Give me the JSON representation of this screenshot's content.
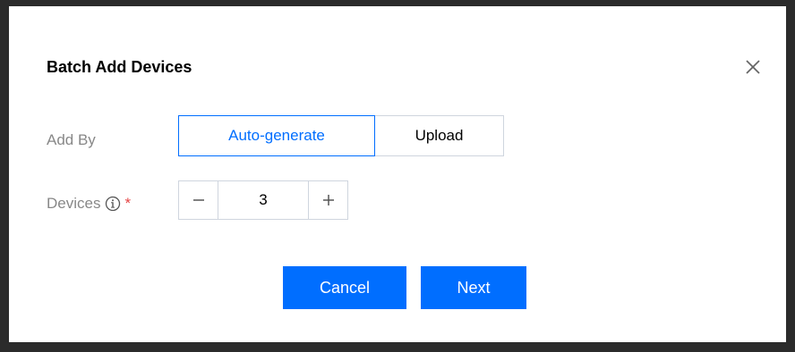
{
  "dialog": {
    "title": "Batch Add Devices",
    "close_icon": "close-icon"
  },
  "form": {
    "add_by": {
      "label": "Add By",
      "options": [
        "Auto-generate",
        "Upload"
      ],
      "selected": "Auto-generate"
    },
    "devices": {
      "label": "Devices",
      "info_icon": "info-icon",
      "required_mark": "*",
      "value": "3",
      "decrement_icon": "minus-icon",
      "increment_icon": "plus-icon"
    }
  },
  "footer": {
    "cancel_label": "Cancel",
    "next_label": "Next"
  },
  "colors": {
    "accent": "#006eff",
    "required": "#e54545",
    "label": "#888888",
    "border": "#cfd5de"
  }
}
